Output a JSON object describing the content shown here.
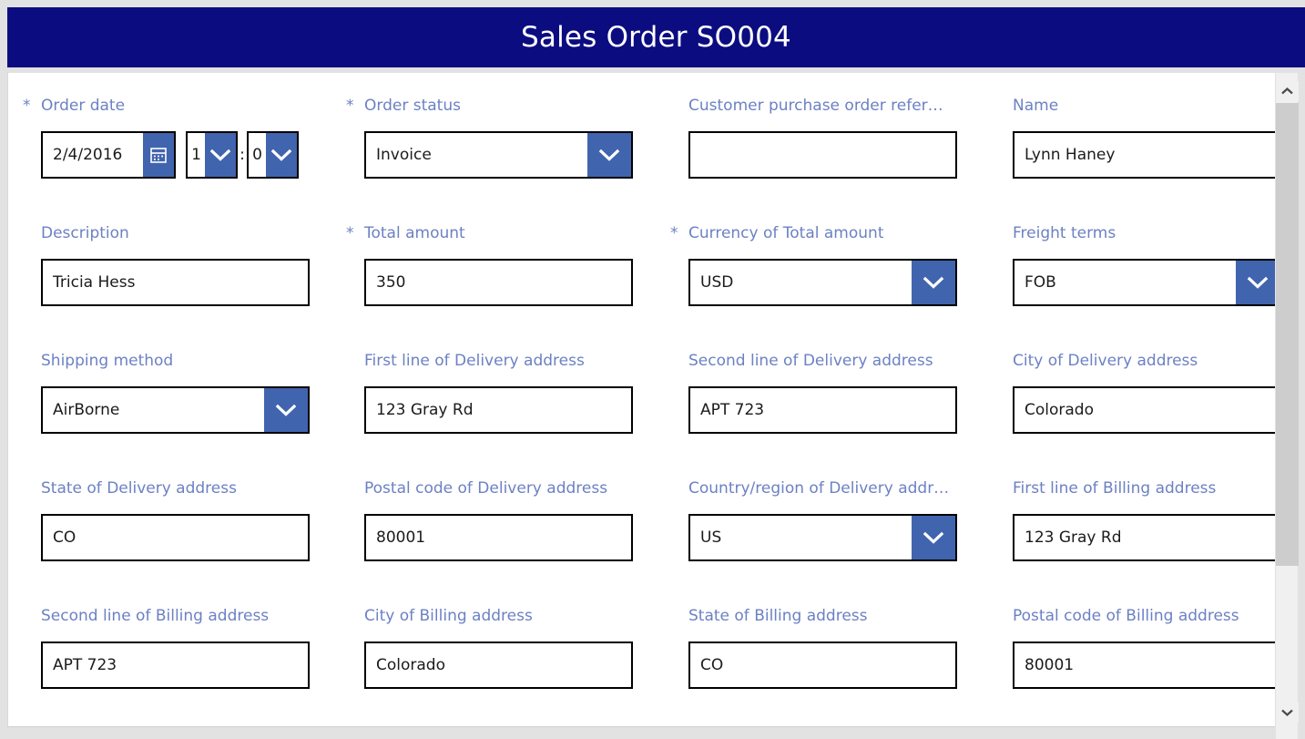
{
  "header": {
    "title": "Sales Order SO004",
    "background_color": "#0c0c81",
    "text_color": "#ffffff"
  },
  "theme": {
    "label_color": "#6c81c4",
    "accent_blue": "#4164ae",
    "field_border": "#000000",
    "canvas_background": "#ffffff"
  },
  "form": {
    "rows": [
      {
        "fields": [
          {
            "label": "Order date",
            "required": true,
            "type": "datetime",
            "date_value": "2/4/2016",
            "hour_value": "1",
            "time_separator": ":",
            "minute_value": "0",
            "calendar_icon": "calendar-icon"
          },
          {
            "label": "Order status",
            "required": true,
            "type": "select",
            "value": "Invoice"
          },
          {
            "label": "Customer purchase order refer…",
            "required": false,
            "type": "text",
            "value": ""
          },
          {
            "label": "Name",
            "required": false,
            "type": "text",
            "value": "Lynn Haney"
          }
        ]
      },
      {
        "fields": [
          {
            "label": "Description",
            "required": false,
            "type": "text",
            "value": "Tricia Hess"
          },
          {
            "label": "Total amount",
            "required": true,
            "type": "text",
            "value": "350"
          },
          {
            "label": "Currency of Total amount",
            "required": true,
            "type": "select",
            "value": "USD"
          },
          {
            "label": "Freight terms",
            "required": false,
            "type": "select",
            "value": "FOB"
          }
        ]
      },
      {
        "fields": [
          {
            "label": "Shipping method",
            "required": false,
            "type": "select",
            "value": "AirBorne"
          },
          {
            "label": "First line of Delivery address",
            "required": false,
            "type": "text",
            "value": "123 Gray Rd"
          },
          {
            "label": "Second line of Delivery address",
            "required": false,
            "type": "text",
            "value": "APT 723"
          },
          {
            "label": "City of Delivery address",
            "required": false,
            "type": "text",
            "value": "Colorado"
          }
        ]
      },
      {
        "fields": [
          {
            "label": "State of Delivery address",
            "required": false,
            "type": "text",
            "value": "CO"
          },
          {
            "label": "Postal code of Delivery address",
            "required": false,
            "type": "text",
            "value": "80001"
          },
          {
            "label": "Country/region of Delivery addr…",
            "required": false,
            "type": "select",
            "value": "US"
          },
          {
            "label": "First line of Billing address",
            "required": false,
            "type": "text",
            "value": "123 Gray Rd"
          }
        ]
      },
      {
        "fields": [
          {
            "label": "Second line of Billing address",
            "required": false,
            "type": "text",
            "value": "APT 723"
          },
          {
            "label": "City of Billing address",
            "required": false,
            "type": "text",
            "value": "Colorado"
          },
          {
            "label": "State of Billing address",
            "required": false,
            "type": "text",
            "value": "CO"
          },
          {
            "label": "Postal code of Billing address",
            "required": false,
            "type": "text",
            "value": "80001"
          }
        ]
      }
    ]
  },
  "scrollbar": {
    "up_icon": "chevron-up-icon",
    "down_icon": "chevron-down-icon",
    "orientation": "vertical"
  },
  "icons": {
    "dropdown": "chevron-down-icon",
    "calendar": "calendar-icon",
    "required": "*"
  }
}
